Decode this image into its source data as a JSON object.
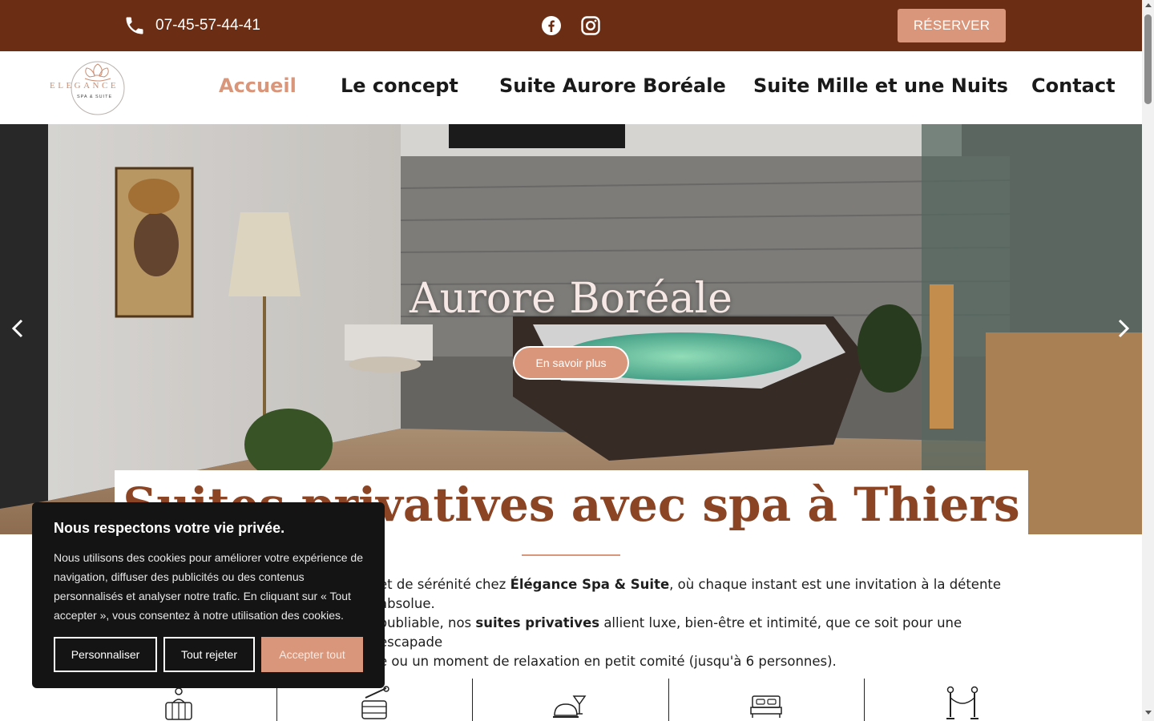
{
  "topbar": {
    "phone": "07-45-57-44-41",
    "reserve_label": "RÉSERVER",
    "social_icons": [
      "facebook-icon",
      "instagram-icon"
    ],
    "background": "#6b2e14"
  },
  "logo": {
    "brand": "ELEGANCE",
    "tagline": "SPA & SUITE"
  },
  "nav": {
    "items": [
      {
        "label": "Accueil",
        "active": true
      },
      {
        "label": "Le concept",
        "active": false
      },
      {
        "label": "Suite Aurore Boréale",
        "active": false
      },
      {
        "label": "Suite Mille et une Nuits",
        "active": false
      },
      {
        "label": "Contact",
        "active": false
      }
    ],
    "accent": "#d9967a"
  },
  "hero": {
    "title": "Aurore Boréale",
    "button_label": "En savoir plus"
  },
  "main": {
    "heading": "Suites privatives avec spa à Thiers",
    "intro_parts": [
      "et de sérénité chez ",
      "Élégance Spa & Suite",
      ", où chaque instant est une invitation à la détente absolue.",
      "oubliable, nos ",
      "suites privatives",
      " allient luxe, bien-être et intimité, que ce soit pour une escapade",
      "e ou un moment de relaxation en petit comité (jusqu'à 6 personnes)."
    ],
    "heading_color": "#8b4424"
  },
  "features": [
    "hot-tub-icon",
    "sauna-bucket-icon",
    "cocktail-cloche-icon",
    "bed-icon",
    "vip-rope-icon"
  ],
  "cookie": {
    "title": "Nous respectons votre vie privée.",
    "text": "Nous utilisons des cookies pour améliorer votre expérience de navigation, diffuser des publicités ou des contenus personnalisés et analyser notre trafic. En cliquant sur « Tout accepter », vous consentez à notre utilisation des cookies.",
    "buttons": {
      "customize": "Personnaliser",
      "reject": "Tout rejeter",
      "accept": "Accepter tout"
    }
  }
}
